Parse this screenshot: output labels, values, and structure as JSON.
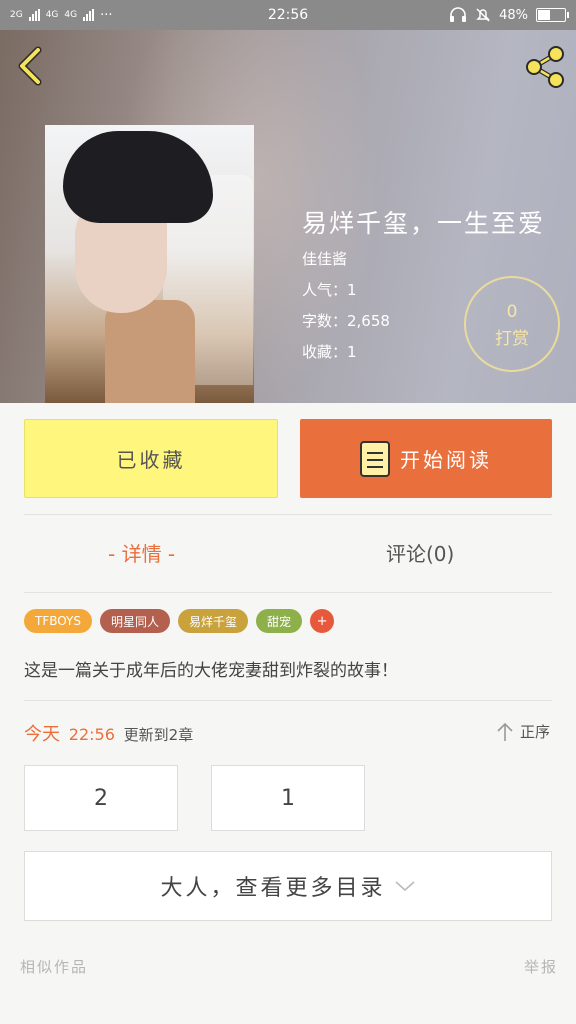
{
  "status_bar": {
    "network_1": "2G",
    "network_2": "4G",
    "network_3": "4G",
    "dots": "···",
    "time": "22:56",
    "battery": "48%",
    "battery_fraction": 0.48
  },
  "header": {
    "back_icon": "chevron-left-icon",
    "share_icon": "share-icon"
  },
  "book": {
    "title": "易烊千玺，一生至爱",
    "author": "佳佳酱",
    "popularity": "人气：1",
    "word_count": "字数：2,658",
    "favorites": "收藏：1"
  },
  "tip": {
    "count": "0",
    "label": "打赏"
  },
  "actions": {
    "collected": "已收藏",
    "start_reading": "开始阅读"
  },
  "tabs": {
    "details": "- 详情 -",
    "comments": "评论(0)"
  },
  "tags": [
    {
      "label": "TFBOYS",
      "color": "#f4a83a"
    },
    {
      "label": "明星同人",
      "color": "#b3604f"
    },
    {
      "label": "易烊千玺",
      "color": "#c9a23c"
    },
    {
      "label": "甜宠",
      "color": "#8db04a"
    },
    {
      "label": "+",
      "color": "#e8593b"
    }
  ],
  "description": "这是一篇关于成年后的大佬宠妻甜到炸裂的故事！",
  "update": {
    "today": "今天",
    "time": "22:56",
    "text": "更新到2章"
  },
  "sort_label": "正序",
  "chapters": [
    "2",
    "1"
  ],
  "more": "大人，查看更多目录",
  "footer": {
    "similar": "相似作品",
    "report": "举报"
  },
  "colors": {
    "accent": "#e96f3d",
    "collected_bg": "#fff67d",
    "tip_ring": "#f5e196"
  }
}
